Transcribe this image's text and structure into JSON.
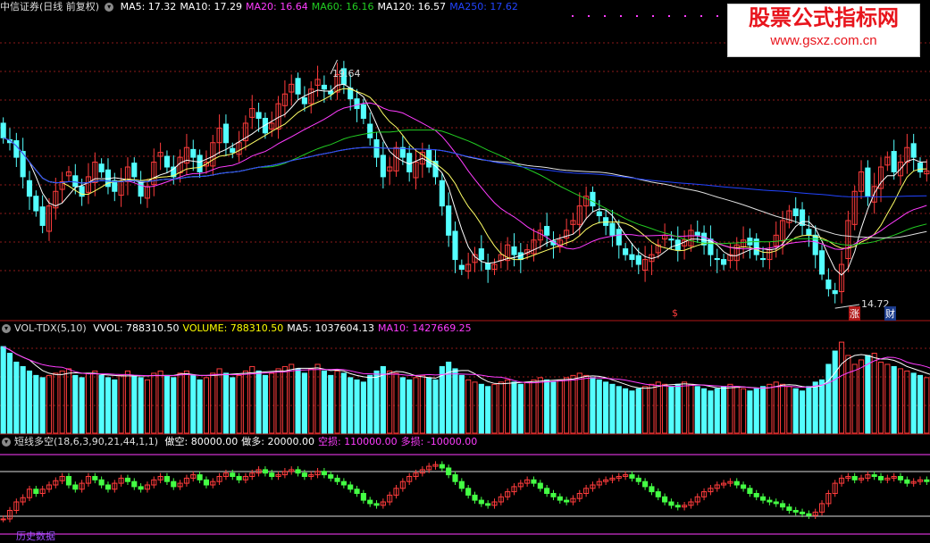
{
  "panel1": {
    "title": "中信证券(日线 前复权)",
    "legend": [
      {
        "label": "MA5: 17.32",
        "color": "#ffffff"
      },
      {
        "label": "MA10: 17.29",
        "color": "#ffffff"
      },
      {
        "label": "MA20: 16.64",
        "color": "#ff3cff"
      },
      {
        "label": "MA60: 16.16",
        "color": "#22cc22"
      },
      {
        "label": "MA120: 16.57",
        "color": "#ffffff"
      },
      {
        "label": "MA250: 17.62",
        "color": "#2244ff"
      }
    ],
    "high_label": "19.64",
    "low_label": "14.72",
    "markers": {
      "dollar": "$",
      "zhang": "涨",
      "cai": "财"
    }
  },
  "panel2": {
    "title": "VOL-TDX(5,10)",
    "legend": [
      {
        "label": "VVOL: 788310.50",
        "color": "#ffffff"
      },
      {
        "label": "VOLUME: 788310.50",
        "color": "#ffff00"
      },
      {
        "label": "MA5: 1037604.13",
        "color": "#ffffff"
      },
      {
        "label": "MA10: 1427669.25",
        "color": "#ff3cff"
      }
    ]
  },
  "panel3": {
    "title": "短线多空(18,6,3,90,21,44,1,1)",
    "legend": [
      {
        "label": "做空: 80000.00",
        "color": "#ffffff"
      },
      {
        "label": "做多: 20000.00",
        "color": "#ffffff"
      },
      {
        "label": "空损: 110000.00",
        "color": "#ff3cff"
      },
      {
        "label": "多损: -10000.00",
        "color": "#ff3cff"
      }
    ],
    "bottom_text": "历史数据"
  },
  "watermark": {
    "line1": "股票公式指标网",
    "line2": "www.gsxz.com.cn"
  },
  "colors": {
    "up": "#ff3c3c",
    "down": "#54ffff",
    "grid": "#8b1a1a",
    "divider": "#b01818",
    "ma5": "#ffffff",
    "ma10": "#ffff66",
    "ma20": "#ff3cff",
    "ma60": "#22cc22",
    "ma120": "#e0e0e0",
    "ma250": "#2244ff"
  },
  "chart_data": [
    {
      "type": "candlestick",
      "title": "中信证券(日线 前复权)",
      "series": [
        {
          "name": "MA5",
          "last": 17.32
        },
        {
          "name": "MA10",
          "last": 17.29
        },
        {
          "name": "MA20",
          "last": 16.64
        },
        {
          "name": "MA60",
          "last": 16.16
        },
        {
          "name": "MA120",
          "last": 16.57
        },
        {
          "name": "MA250",
          "last": 17.62
        }
      ],
      "ylim": [
        14.3,
        20.5
      ],
      "annotations": [
        {
          "text": "19.64",
          "kind": "high"
        },
        {
          "text": "14.72",
          "kind": "low"
        }
      ],
      "close": [
        18.0,
        17.9,
        17.6,
        17.2,
        16.8,
        16.5,
        16.2,
        16.6,
        16.9,
        17.1,
        17.3,
        17.0,
        16.8,
        17.2,
        17.5,
        17.3,
        17.0,
        16.9,
        17.1,
        17.4,
        17.2,
        16.8,
        17.0,
        17.5,
        17.7,
        17.4,
        17.2,
        17.6,
        17.8,
        17.6,
        17.3,
        17.5,
        17.9,
        18.2,
        17.9,
        17.7,
        17.9,
        18.3,
        18.6,
        18.4,
        18.1,
        18.3,
        18.7,
        18.9,
        19.1,
        18.9,
        18.7,
        19.0,
        19.2,
        19.0,
        18.9,
        19.3,
        19.1,
        18.8,
        18.6,
        18.4,
        18.0,
        17.6,
        17.2,
        17.4,
        17.8,
        17.6,
        17.3,
        17.5,
        17.7,
        17.4,
        17.2,
        16.6,
        16.0,
        15.5,
        15.3,
        15.4,
        15.6,
        15.5,
        15.3,
        15.4,
        15.6,
        15.8,
        15.6,
        15.5,
        15.7,
        15.9,
        16.1,
        16.0,
        15.8,
        15.9,
        16.1,
        16.3,
        16.6,
        16.8,
        16.6,
        16.4,
        16.2,
        16.0,
        15.8,
        15.6,
        15.5,
        15.4,
        15.5,
        15.6,
        15.8,
        16.0,
        15.9,
        15.7,
        15.9,
        16.1,
        16.0,
        15.8,
        15.6,
        15.5,
        15.4,
        15.6,
        15.8,
        15.9,
        15.8,
        15.6,
        15.5,
        15.7,
        16.0,
        16.3,
        16.5,
        16.4,
        16.2,
        16.0,
        15.6,
        15.2,
        14.9,
        14.8,
        15.4,
        16.3,
        16.9,
        17.3,
        16.8,
        17.0,
        17.4,
        17.6,
        17.3,
        17.5,
        17.8,
        17.6,
        17.3,
        17.32
      ],
      "volume": [
        780,
        720,
        640,
        600,
        560,
        520,
        500,
        520,
        540,
        560,
        580,
        520,
        500,
        540,
        560,
        520,
        500,
        480,
        520,
        560,
        520,
        500,
        480,
        540,
        560,
        520,
        500,
        540,
        560,
        520,
        480,
        500,
        540,
        580,
        540,
        500,
        520,
        560,
        600,
        560,
        520,
        540,
        580,
        600,
        620,
        580,
        540,
        580,
        620,
        560,
        520,
        560,
        540,
        500,
        480,
        460,
        520,
        560,
        600,
        560,
        540,
        500,
        480,
        500,
        520,
        500,
        480,
        600,
        640,
        580,
        520,
        480,
        460,
        440,
        420,
        440,
        460,
        480,
        460,
        440,
        460,
        480,
        500,
        480,
        460,
        480,
        500,
        520,
        540,
        520,
        500,
        480,
        460,
        440,
        420,
        400,
        380,
        400,
        420,
        440,
        460,
        440,
        420,
        440,
        460,
        440,
        420,
        400,
        380,
        400,
        420,
        440,
        420,
        400,
        380,
        400,
        420,
        440,
        460,
        440,
        420,
        400,
        380,
        420,
        460,
        480,
        620,
        740,
        820,
        700,
        620,
        660,
        700,
        720,
        640,
        620,
        600,
        580,
        560,
        540,
        520,
        500,
        480,
        460
      ],
      "osc": [
        20,
        30,
        40,
        45,
        55,
        50,
        55,
        60,
        65,
        70,
        60,
        55,
        62,
        70,
        66,
        60,
        55,
        62,
        68,
        64,
        58,
        55,
        60,
        66,
        70,
        64,
        58,
        62,
        68,
        72,
        66,
        60,
        64,
        70,
        74,
        70,
        66,
        70,
        74,
        78,
        74,
        70,
        72,
        76,
        78,
        74,
        70,
        72,
        76,
        72,
        68,
        64,
        60,
        55,
        50,
        42,
        38,
        36,
        40,
        48,
        56,
        64,
        70,
        74,
        78,
        82,
        84,
        80,
        72,
        64,
        56,
        48,
        42,
        38,
        36,
        40,
        46,
        52,
        58,
        62,
        66,
        62,
        56,
        50,
        46,
        42,
        40,
        44,
        50,
        56,
        60,
        64,
        66,
        68,
        70,
        72,
        68,
        64,
        58,
        52,
        46,
        40,
        36,
        34,
        36,
        40,
        46,
        52,
        56,
        60,
        62,
        64,
        60,
        56,
        50,
        46,
        42,
        40,
        38,
        34,
        30,
        28,
        26,
        24,
        28,
        38,
        50,
        62,
        68,
        70,
        66,
        68,
        72,
        70,
        66,
        68,
        70,
        66,
        62,
        64,
        66,
        64,
        60,
        56
      ]
    },
    {
      "type": "bar",
      "title": "VOL-TDX(5,10)",
      "series": [
        {
          "name": "VVOL",
          "last": 788310.5
        },
        {
          "name": "VOLUME",
          "last": 788310.5
        },
        {
          "name": "MA5",
          "last": 1037604.13
        },
        {
          "name": "MA10",
          "last": 1427669.25
        }
      ]
    },
    {
      "type": "line",
      "title": "短线多空(18,6,3,90,21,44,1,1)",
      "series": [
        {
          "name": "做空",
          "last": 80000.0
        },
        {
          "name": "做多",
          "last": 20000.0
        },
        {
          "name": "空损",
          "last": 110000.0
        },
        {
          "name": "多损",
          "last": -10000.0
        }
      ],
      "ylim": [
        0,
        100
      ]
    }
  ]
}
